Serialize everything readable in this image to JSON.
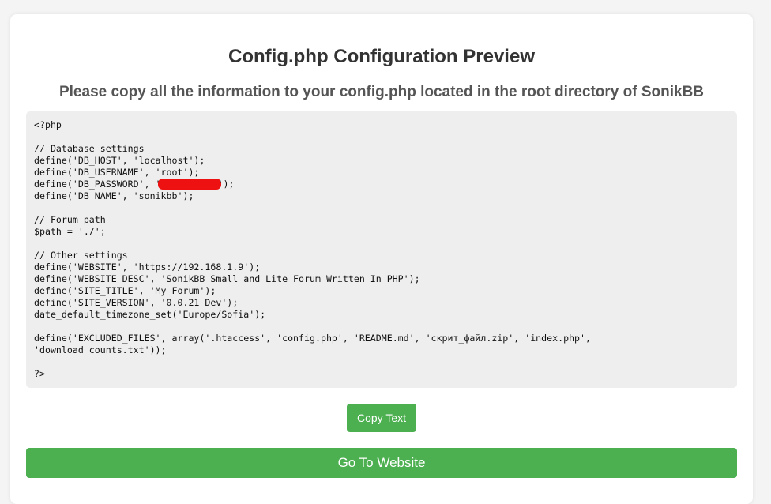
{
  "title": "Config.php Configuration Preview",
  "subtitle": "Please copy all the information to your config.php located in the root directory of SonikBB",
  "code": {
    "line_01": "<?php",
    "line_02": "",
    "line_03": "// Database settings",
    "line_04": "define('DB_HOST', 'localhost');",
    "line_05": "define('DB_USERNAME', 'root');",
    "line_06_prefix": "define('DB_PASSWORD', '",
    "line_06_suffix": "');",
    "line_07": "define('DB_NAME', 'sonikbb');",
    "line_08": "",
    "line_09": "// Forum path",
    "line_10": "$path = './';",
    "line_11": "",
    "line_12": "// Other settings",
    "line_13": "define('WEBSITE', 'https://192.168.1.9');",
    "line_14": "define('WEBSITE_DESC', 'SonikBB Small and Lite Forum Written In PHP');",
    "line_15": "define('SITE_TITLE', 'My Forum');",
    "line_16": "define('SITE_VERSION', '0.0.21 Dev');",
    "line_17": "date_default_timezone_set('Europe/Sofia');",
    "line_18": "",
    "line_19": "define('EXCLUDED_FILES', array('.htaccess', 'config.php', 'README.md', 'скрит_файл.zip', 'index.php',",
    "line_20": "'download_counts.txt'));",
    "line_21": "",
    "line_22": "?>"
  },
  "buttons": {
    "copy_label": "Copy Text",
    "go_label": "Go To Website"
  },
  "colors": {
    "accent": "#4caf50",
    "redaction": "#ee1111"
  }
}
